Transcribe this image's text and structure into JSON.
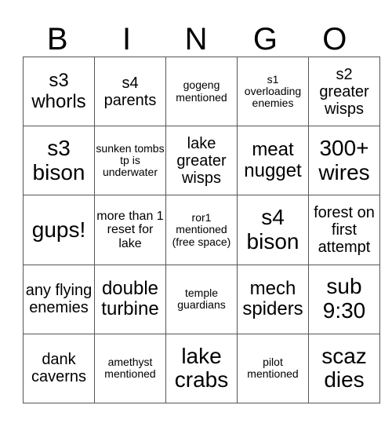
{
  "header": [
    "B",
    "I",
    "N",
    "G",
    "O"
  ],
  "cells": [
    [
      "s3 whorls",
      "s4 parents",
      "gogeng mentioned",
      "s1 overloading enemies",
      "s2 greater wisps"
    ],
    [
      "s3 bison",
      "sunken tombs tp is underwater",
      "lake greater wisps",
      "meat nugget",
      "300+ wires"
    ],
    [
      "gups!",
      "more than 1 reset for lake",
      "ror1 mentioned (free space)",
      "s4 bison",
      "forest on first attempt"
    ],
    [
      "any flying enemies",
      "double turbine",
      "temple guardians",
      "mech spiders",
      "sub 9:30"
    ],
    [
      "dank caverns",
      "amethyst mentioned",
      "lake crabs",
      "pilot mentioned",
      "scaz dies"
    ]
  ]
}
